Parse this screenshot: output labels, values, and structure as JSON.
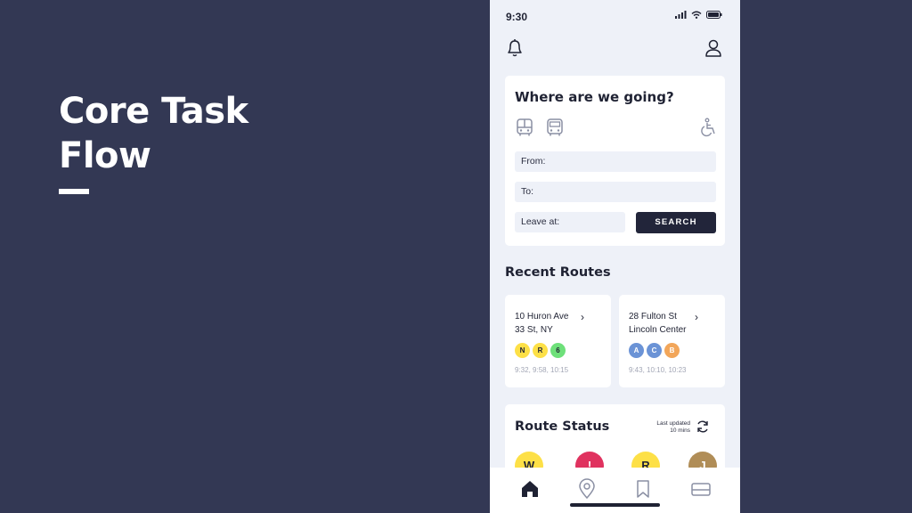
{
  "slide": {
    "title_line1": "Core Task",
    "title_line2": "Flow"
  },
  "status_bar": {
    "time": "9:30"
  },
  "search": {
    "title": "Where are we going?",
    "from_label": "From:",
    "to_label": "To:",
    "leave_label": "Leave at:",
    "button_label": "SEARCH"
  },
  "recent": {
    "title": "Recent Routes",
    "routes": [
      {
        "line1": "10 Huron Ave",
        "line2": "33 St, NY",
        "chevron": "›",
        "badges": [
          "N",
          "R",
          "6"
        ],
        "times": "9:32, 9:58, 10:15"
      },
      {
        "line1": "28 Fulton St",
        "line2": "Lincoln Center",
        "chevron": "›",
        "badges": [
          "A",
          "C",
          "B"
        ],
        "times": "9:43, 10:10, 10:23"
      }
    ]
  },
  "route_status": {
    "title": "Route Status",
    "updated_line1": "Last updated",
    "updated_line2": "10 mins",
    "lines": [
      "W",
      "!",
      "R",
      "J"
    ]
  },
  "colors": {
    "background": "#333854",
    "phone_bg": "#eef1f8",
    "dark": "#22253a",
    "badge_yellow": "#fde047",
    "badge_green": "#6ee07a",
    "badge_blue": "#6b93d6",
    "badge_orange": "#f2a65a",
    "alert_red": "#e0325f",
    "brown": "#b08d57"
  },
  "icons": [
    "bell-icon",
    "profile-icon",
    "bus-icon",
    "tram-icon",
    "wheelchair-icon",
    "refresh-icon",
    "home-icon",
    "location-pin-icon",
    "bookmark-icon",
    "ticket-icon"
  ]
}
